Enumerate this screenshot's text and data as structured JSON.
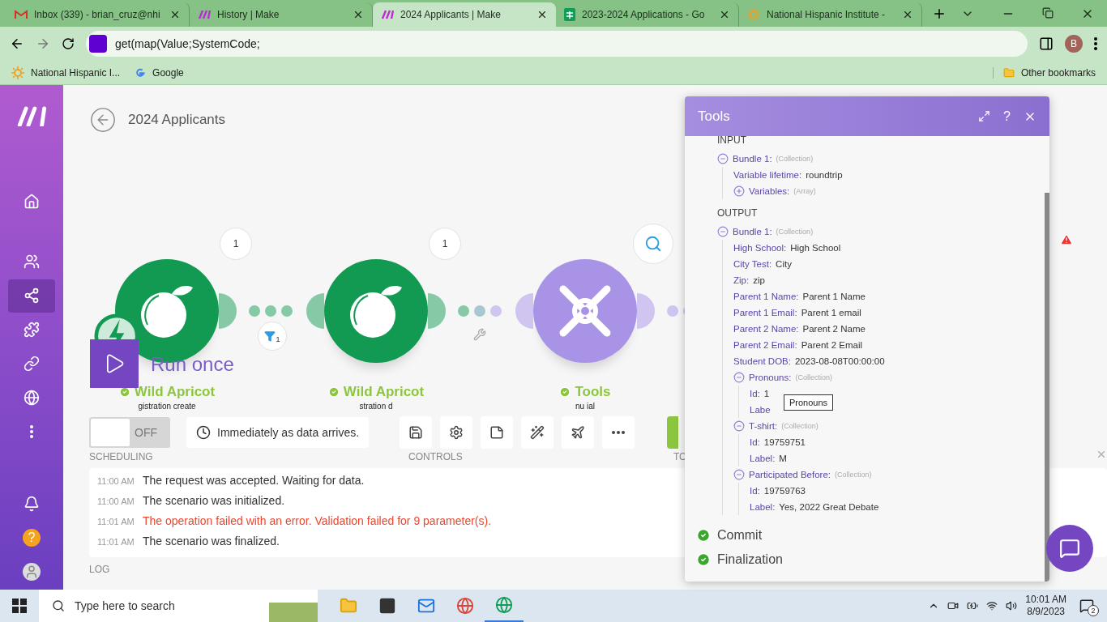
{
  "browser": {
    "tabs": [
      {
        "kind": "mail",
        "title": "Inbox (339) - brian_cruz@nhi",
        "selected": false
      },
      {
        "kind": "make",
        "title": "History | Make",
        "selected": false
      },
      {
        "kind": "make",
        "title": "2024 Applicants | Make",
        "selected": true
      },
      {
        "kind": "sheets",
        "title": "2023-2024 Applications - Go",
        "selected": false
      },
      {
        "kind": "sun",
        "title": "National Hispanic Institute - ",
        "selected": false
      }
    ],
    "address": "get(map(Value;SystemCode;",
    "profile": "B",
    "bookmarks": [
      {
        "kind": "sun",
        "label": "National Hispanic I..."
      },
      {
        "kind": "google",
        "label": "Google"
      }
    ],
    "other_bookmarks": "Other bookmarks"
  },
  "sidebar": {
    "items": [
      {
        "kind": "home",
        "selected": false
      },
      {
        "kind": "users",
        "selected": false
      },
      {
        "kind": "share",
        "selected": true
      },
      {
        "kind": "puzzle",
        "selected": false
      },
      {
        "kind": "link",
        "selected": false
      },
      {
        "kind": "globe",
        "selected": false
      },
      {
        "kind": "more",
        "selected": false
      }
    ],
    "bottom": [
      {
        "kind": "bell"
      },
      {
        "kind": "help",
        "label": "?"
      },
      {
        "kind": "user"
      }
    ]
  },
  "scenario": {
    "title": "2024 Applicants",
    "modules": [
      {
        "kind": "app",
        "name": "Wild Apricot",
        "subtitle": "gistration create",
        "bubble": "1"
      },
      {
        "kind": "app",
        "name": "Wild Apricot",
        "subtitle": "stration d",
        "bubble": "1"
      },
      {
        "kind": "tools",
        "name": "Tools",
        "subtitle": "nu ial"
      }
    ],
    "filter_count": "1",
    "run_label": "Run once",
    "toggle": {
      "label": "OFF",
      "on": false
    },
    "schedule": "Immediately as data arrives.",
    "section_labels": [
      "SCHEDULING",
      "CONTROLS",
      "TO"
    ],
    "log": [
      {
        "time": "11:00 AM",
        "text": "The request was accepted. Waiting for data.",
        "kind": "info"
      },
      {
        "time": "11:00 AM",
        "text": "The scenario was initialized.",
        "kind": "info"
      },
      {
        "time": "11:01 AM",
        "text": "The operation failed with an error. Validation failed for 9 parameter(s).",
        "kind": "error"
      },
      {
        "time": "11:01 AM",
        "text": "The scenario was finalized.",
        "kind": "info"
      }
    ],
    "log_label": "LOG"
  },
  "tools": {
    "title": "Tools",
    "help": "?",
    "sections": [
      {
        "heading": "INPUT",
        "tree": [
          {
            "key": "Bundle 1:",
            "type": "(Collection)",
            "expanded": true,
            "children": [
              {
                "key": "Variable lifetime:",
                "value": "roundtrip"
              },
              {
                "key": "Variables:",
                "type": "(Array)",
                "expanded": false
              }
            ]
          }
        ]
      },
      {
        "heading": "OUTPUT",
        "tree": [
          {
            "key": "Bundle 1:",
            "type": "(Collection)",
            "expanded": true,
            "children": [
              {
                "key": "High School:",
                "value": "High School"
              },
              {
                "key": "City Test:",
                "value": "City"
              },
              {
                "key": "Zip:",
                "value": "zip"
              },
              {
                "key": "Parent 1 Name:",
                "value": "Parent 1 Name"
              },
              {
                "key": "Parent 1 Email:",
                "value": "Parent 1 email"
              },
              {
                "key": "Parent 2 Name:",
                "value": "Parent 2 Name"
              },
              {
                "key": "Parent 2 Email:",
                "value": "Parent 2 Email"
              },
              {
                "key": "Student DOB:",
                "value": "2023-08-08T00:00:00"
              },
              {
                "key": "Pronouns:",
                "type": "(Collection)",
                "expanded": true,
                "children": [
                  {
                    "key": "Id:",
                    "value": "1",
                    "tooltip": "Pronouns"
                  },
                  {
                    "key": "Labe"
                  }
                ]
              },
              {
                "key": "T-shirt:",
                "type": "(Collection)",
                "expanded": true,
                "children": [
                  {
                    "key": "Id:",
                    "value": "19759751"
                  },
                  {
                    "key": "Label:",
                    "value": "M"
                  }
                ]
              },
              {
                "key": "Participated Before:",
                "type": "(Collection)",
                "expanded": true,
                "children": [
                  {
                    "key": "Id:",
                    "value": "19759763"
                  },
                  {
                    "key": "Label:",
                    "value": "Yes, 2022 Great Debate"
                  }
                ]
              }
            ]
          }
        ]
      }
    ],
    "steps": [
      {
        "label": "Commit",
        "done": true
      },
      {
        "label": "Finalization",
        "done": true
      }
    ]
  },
  "taskbar": {
    "search_placeholder": "Type here to search",
    "time": "10:01 AM",
    "date": "8/9/2023",
    "notifications": "2"
  }
}
